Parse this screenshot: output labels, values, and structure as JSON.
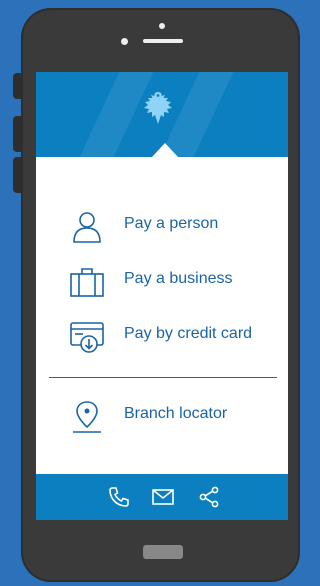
{
  "colors": {
    "background": "#2b72bb",
    "brand": "#0b7fc0",
    "text_accent": "#1a64a5",
    "device": "#3a3a3a"
  },
  "header": {
    "logo_icon": "eagle-logo-icon"
  },
  "menu": {
    "items": [
      {
        "label": "Pay a person",
        "icon": "person-icon"
      },
      {
        "label": "Pay a business",
        "icon": "briefcase-icon"
      },
      {
        "label": "Pay by credit card",
        "icon": "credit-card-download-icon"
      },
      {
        "label": "Branch locator",
        "icon": "location-pin-icon"
      }
    ]
  },
  "footer": {
    "icons": [
      "phone-icon",
      "mail-icon",
      "share-icon"
    ]
  }
}
